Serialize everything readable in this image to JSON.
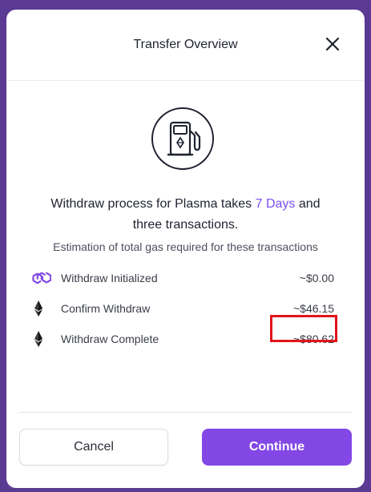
{
  "modal": {
    "title": "Transfer Overview",
    "close_icon": "close-icon",
    "gas_icon": "gas-pump-icon"
  },
  "headline": {
    "part1": "Withdraw process for Plasma takes ",
    "accent": "7 Days",
    "part2": " and",
    "line2": "three transactions."
  },
  "subline": "Estimation of total gas required for these transactions",
  "rows": [
    {
      "label": "Withdraw Initialized",
      "value": "~$0.00",
      "icon": "polygon-icon"
    },
    {
      "label": "Confirm Withdraw",
      "value": "~$46.15",
      "icon": "ethereum-icon"
    },
    {
      "label": "Withdraw Complete",
      "value": "~$80.62",
      "icon": "ethereum-icon"
    }
  ],
  "buttons": {
    "cancel": "Cancel",
    "continue": "Continue"
  },
  "colors": {
    "backdrop": "#5b3a93",
    "accent": "#7b4ff2",
    "primary_button": "#8247e5",
    "highlight": "#e1141c",
    "polygon": "#8247e5"
  }
}
